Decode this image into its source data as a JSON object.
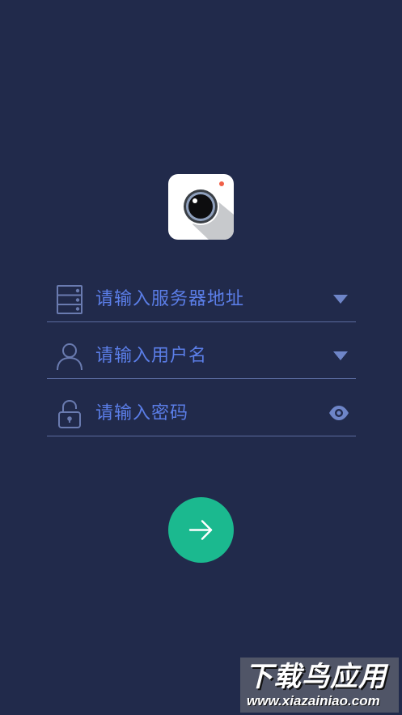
{
  "app": {
    "icon": "camera-app-icon"
  },
  "form": {
    "server": {
      "placeholder": "请输入服务器地址",
      "icon": "server-icon",
      "trailing_icon": "dropdown-arrow-icon"
    },
    "username": {
      "placeholder": "请输入用户名",
      "icon": "user-icon",
      "trailing_icon": "dropdown-arrow-icon"
    },
    "password": {
      "placeholder": "请输入密码",
      "icon": "lock-icon",
      "trailing_icon": "eye-icon"
    },
    "submit": {
      "icon": "arrow-right-icon"
    }
  },
  "watermark": {
    "main": "下载鸟应用",
    "sub": "www.xiazainiao.com"
  },
  "colors": {
    "background": "#212a4b",
    "accent_text": "#5b7ee8",
    "field_icon": "#6a7bb0",
    "submit_button": "#1bb98f"
  }
}
